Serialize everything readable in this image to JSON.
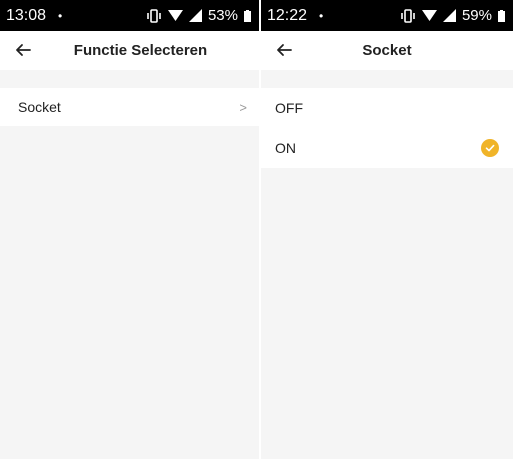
{
  "left_screen": {
    "status": {
      "time": "13:08",
      "battery": "53%"
    },
    "header": {
      "title": "Functie Selecteren"
    },
    "list": [
      {
        "label": "Socket"
      }
    ]
  },
  "right_screen": {
    "status": {
      "time": "12:22",
      "battery": "59%"
    },
    "header": {
      "title": "Socket"
    },
    "options": [
      {
        "label": "OFF",
        "selected": false
      },
      {
        "label": "ON",
        "selected": true
      }
    ]
  },
  "icons": {
    "back": "arrow-left-icon",
    "chevron": "chevron-right-icon",
    "check": "check-circle-icon",
    "signal": "signal-icon",
    "wifi": "wifi-icon",
    "vibrate": "vibrate-icon",
    "battery": "battery-icon"
  },
  "colors": {
    "accent": "#f0b429",
    "background": "#f5f5f5",
    "statusbar": "#000000"
  }
}
